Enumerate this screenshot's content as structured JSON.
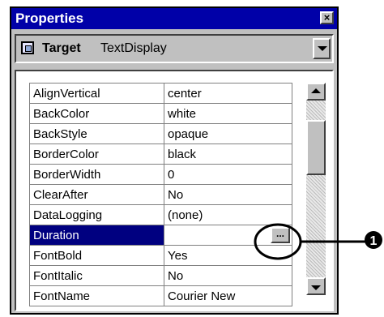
{
  "window": {
    "title": "Properties",
    "close_label": "×"
  },
  "target": {
    "label": "Target",
    "value": "TextDisplay"
  },
  "properties": [
    {
      "name": "AlignVertical",
      "value": "center"
    },
    {
      "name": "BackColor",
      "value": "white"
    },
    {
      "name": "BackStyle",
      "value": "opaque"
    },
    {
      "name": "BorderColor",
      "value": "black"
    },
    {
      "name": "BorderWidth",
      "value": "0"
    },
    {
      "name": "ClearAfter",
      "value": "No"
    },
    {
      "name": "DataLogging",
      "value": "(none)"
    },
    {
      "name": "Duration",
      "value": ""
    },
    {
      "name": "FontBold",
      "value": "Yes"
    },
    {
      "name": "FontItalic",
      "value": "No"
    },
    {
      "name": "FontName",
      "value": "Courier New"
    }
  ],
  "selected_property": "Duration",
  "ellipsis_label": "...",
  "callout": {
    "label": "1"
  },
  "colors": {
    "titlebar": "#0000a8",
    "selection": "#000080",
    "panel": "#c0c0c0"
  }
}
